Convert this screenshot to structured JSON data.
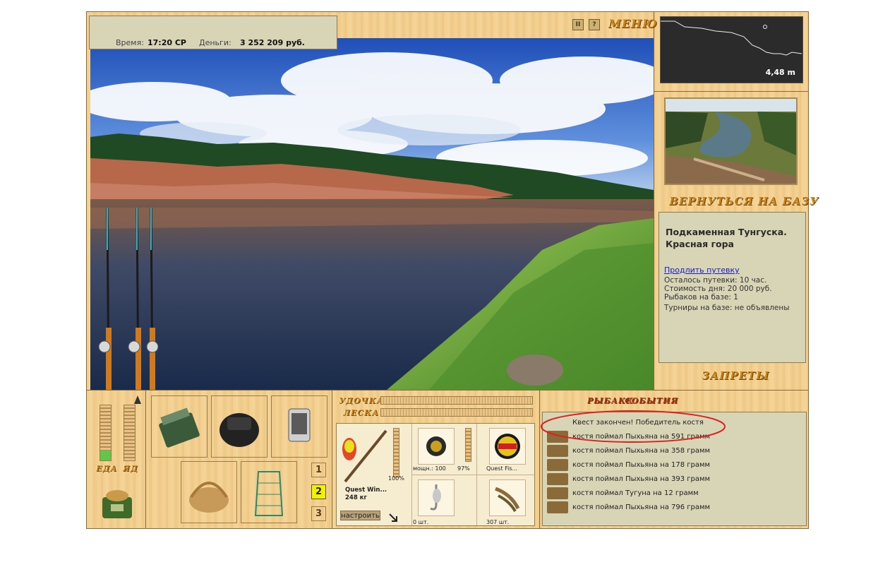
{
  "status": {
    "time_label": "Время:",
    "time_value": "17:20 СР",
    "money_label": "Деньги:",
    "money_value": "3 252 209 руб."
  },
  "top_menu": {
    "pause_label": "II",
    "help_label": "?",
    "menu_label": "МЕНЮ"
  },
  "depth_map": {
    "depth_value": "4,48 m"
  },
  "location": {
    "return_label": "ВЕРНУТЬСЯ НА БАЗУ",
    "title_line1": "Подкаменная Тунгуска.",
    "title_line2": "Красная гора",
    "extend_link": "Продлить путевку",
    "lines": [
      "Осталось путевки: 10 час.",
      "Стоимость дня: 20 000 руб.",
      "Рыбаков на базе: 1",
      "Турниры на базе: не объявлены"
    ],
    "bans_label": "ЗАПРЕТЫ"
  },
  "gauges": {
    "food_label": "ЕДА",
    "poison_label": "ЯД"
  },
  "slots": {
    "numbers": [
      "1",
      "2",
      "3"
    ],
    "active": "2"
  },
  "tackle": {
    "rod_label": "УДОЧКА",
    "line_label": "ЛЕСКА",
    "rod_name": "Quest Win...",
    "rod_weight": "248 кг",
    "rod_percent": "100%",
    "reel_power": "мощн.: 100",
    "reel_percent": "97%",
    "line_name": "Quest Fis...",
    "hooks_count": "0 шт.",
    "bait_count": "307 шт.",
    "configure_label": "настроить"
  },
  "events": {
    "tab_fishers": "РЫБАКИ",
    "tab_events": "СОБЫТИЯ",
    "rows": [
      {
        "text": "Квест закончен! Победитель костя",
        "fish": false
      },
      {
        "text": "костя поймал Пыхьяна на 591 грамм",
        "fish": true
      },
      {
        "text": "костя поймал Пыхьяна на 358 грамм",
        "fish": true
      },
      {
        "text": "костя поймал Пыхьяна на 178 грамм",
        "fish": true
      },
      {
        "text": "костя поймал Пыхьяна на 393 грамм",
        "fish": true
      },
      {
        "text": "костя поймал Тугуна на 12 грамм",
        "fish": true
      },
      {
        "text": "костя поймал Пыхьяна на 796 грамм",
        "fish": true
      }
    ]
  },
  "colors": {
    "wood": "#f2cf8e",
    "panel": "#d8d5b6",
    "accent_carved": "#c8861c",
    "active_slot": "#f2f200",
    "highlight_circle": "#e02020"
  },
  "icons": [
    "pause-icon",
    "help-icon",
    "tackle-box-icon",
    "backpack-icon",
    "pda-icon",
    "picnic-basket-icon",
    "keepnet-icon",
    "food-bag-icon",
    "fishing-rod-icon",
    "reel-icon",
    "line-spool-icon",
    "hook-icon",
    "bait-icon",
    "fish-icon",
    "configure-arrow-icon"
  ]
}
